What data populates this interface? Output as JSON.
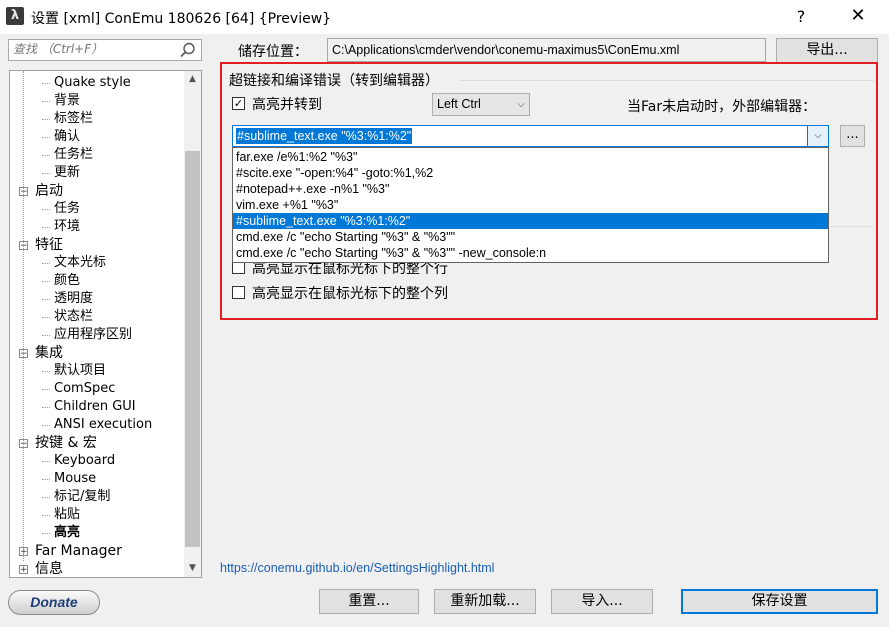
{
  "window": {
    "app_icon": "λ",
    "title": "设置 [xml] ConEmu 180626 [64] {Preview}",
    "help_label": "?",
    "close_label": "✕"
  },
  "search": {
    "placeholder": "查找 （Ctrl+F）",
    "icon": "search-icon"
  },
  "tree": {
    "items": [
      {
        "label": "Quake style",
        "level": 2
      },
      {
        "label": "背景",
        "level": 2
      },
      {
        "label": "标签栏",
        "level": 2
      },
      {
        "label": "确认",
        "level": 2
      },
      {
        "label": "任务栏",
        "level": 2
      },
      {
        "label": "更新",
        "level": 2
      },
      {
        "label": "启动",
        "level": 1,
        "expander": "⊟"
      },
      {
        "label": "任务",
        "level": 2
      },
      {
        "label": "环境",
        "level": 2
      },
      {
        "label": "特征",
        "level": 1,
        "expander": "⊟"
      },
      {
        "label": "文本光标",
        "level": 2
      },
      {
        "label": "颜色",
        "level": 2
      },
      {
        "label": "透明度",
        "level": 2
      },
      {
        "label": "状态栏",
        "level": 2
      },
      {
        "label": "应用程序区别",
        "level": 2
      },
      {
        "label": "集成",
        "level": 1,
        "expander": "⊟"
      },
      {
        "label": "默认项目",
        "level": 2
      },
      {
        "label": "ComSpec",
        "level": 2
      },
      {
        "label": "Children GUI",
        "level": 2
      },
      {
        "label": "ANSI execution",
        "level": 2
      },
      {
        "label": "按键 & 宏",
        "level": 1,
        "expander": "⊟"
      },
      {
        "label": "Keyboard",
        "level": 2
      },
      {
        "label": "Mouse",
        "level": 2
      },
      {
        "label": "标记/复制",
        "level": 2
      },
      {
        "label": "粘贴",
        "level": 2
      },
      {
        "label": "高亮",
        "level": 2,
        "selected": true
      },
      {
        "label": "Far Manager",
        "level": 1,
        "expander": "⊞"
      },
      {
        "label": "信息",
        "level": 1,
        "expander": "⊞"
      }
    ]
  },
  "donate_label": "Donate",
  "storage": {
    "label": "储存位置：",
    "path": "C:\\Applications\\cmder\\vendor\\conemu-maximus5\\ConEmu.xml",
    "export_label": "导出..."
  },
  "hyperlink_group": {
    "title": "超链接和编译错误（转到编辑器）",
    "highlight_goto": {
      "label": "高亮并转到",
      "checked": true,
      "mark": "✓"
    },
    "modifier": {
      "value": "Left Ctrl",
      "chevron": "⌵"
    },
    "far_label": "当Far未启动时，外部编辑器：",
    "editor": {
      "value": "#sublime_text.exe \"%3:%1:%2\"",
      "browse_label": "...",
      "drop_icon": "⌵",
      "options": [
        "far.exe /e%1:%2 \"%3\"",
        "#scite.exe \"-open:%4\" -goto:%1,%2",
        "#notepad++.exe -n%1 \"%3\"",
        "vim.exe +%1 \"%3\"",
        "#sublime_text.exe \"%3:%1:%2\"",
        "cmd.exe /c \"echo Starting \"%3\" & \"%3\"\"",
        "cmd.exe /c \"echo Starting \"%3\" & \"%3\"\" -new_console:n"
      ],
      "selected_index": 4
    },
    "highlight_row": {
      "label": "高亮显示在鼠标光标下的整个行",
      "checked": false
    },
    "highlight_col": {
      "label": "高亮显示在鼠标光标下的整个列",
      "checked": false
    }
  },
  "help_link": "https://conemu.github.io/en/SettingsHighlight.html",
  "buttons": {
    "reset": "重置...",
    "reload": "重新加载...",
    "import": "导入...",
    "save": "保存设置"
  },
  "colors": {
    "accent": "#0078d7",
    "highlight_frame": "#e02020",
    "link": "#1a5fb4"
  }
}
